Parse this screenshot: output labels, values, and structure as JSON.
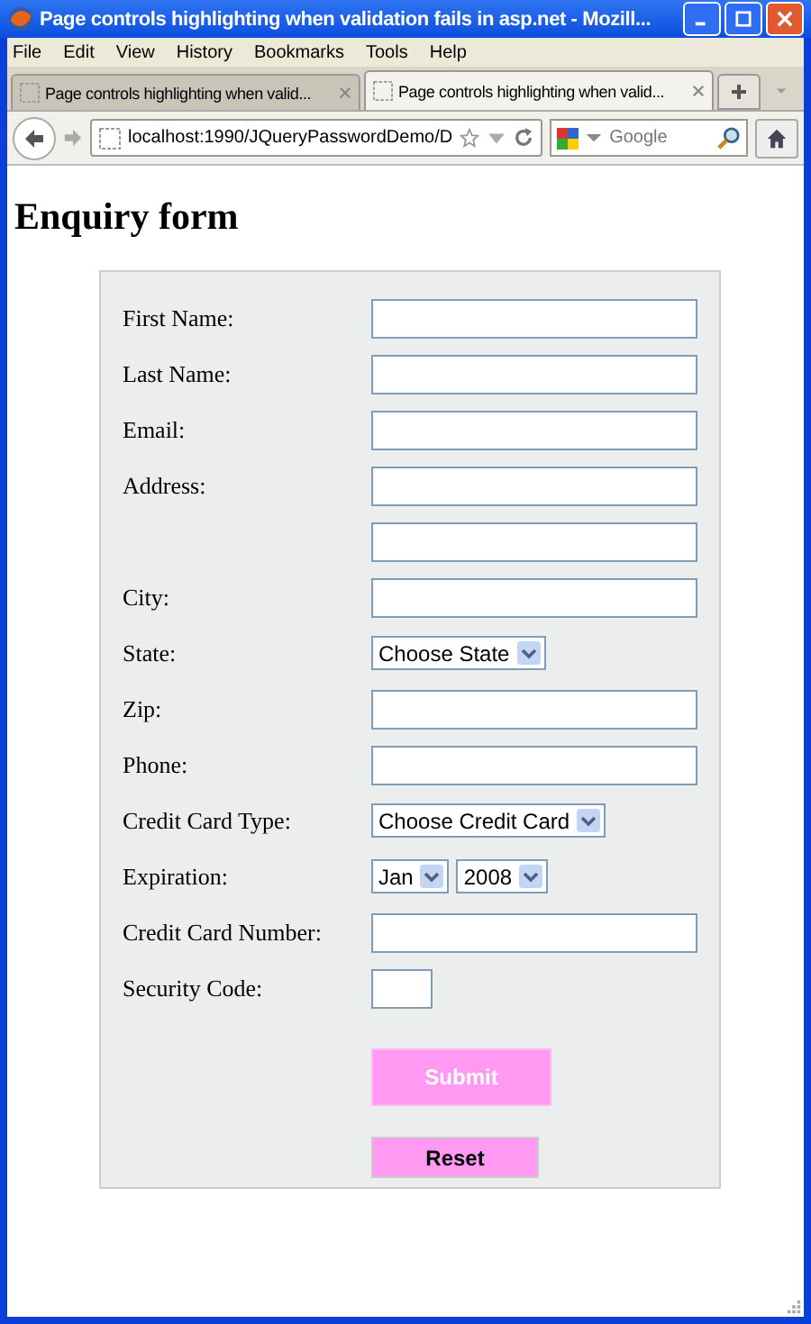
{
  "window": {
    "title": "Page controls highlighting when validation fails in asp.net - Mozill..."
  },
  "menu": [
    "File",
    "Edit",
    "View",
    "History",
    "Bookmarks",
    "Tools",
    "Help"
  ],
  "tabs": [
    {
      "label": "Page controls highlighting when valid...",
      "selected": false
    },
    {
      "label": "Page controls highlighting when valid...",
      "selected": true
    }
  ],
  "address_bar": {
    "value": "localhost:1990/JQueryPasswordDemo/D"
  },
  "search": {
    "placeholder": "Google"
  },
  "page": {
    "heading": "Enquiry form",
    "fields": [
      {
        "kind": "text",
        "label": "First Name:"
      },
      {
        "kind": "text",
        "label": "Last Name:"
      },
      {
        "kind": "text",
        "label": "Email:"
      },
      {
        "kind": "text",
        "label": "Address:"
      },
      {
        "kind": "text"
      },
      {
        "kind": "text",
        "label": "City:"
      },
      {
        "kind": "select",
        "label": "State:",
        "values": [
          "Choose State"
        ]
      },
      {
        "kind": "text",
        "label": "Zip:"
      },
      {
        "kind": "text",
        "label": "Phone:"
      },
      {
        "kind": "select",
        "label": "Credit Card Type:",
        "values": [
          "Choose Credit Card"
        ]
      },
      {
        "kind": "select",
        "label": "Expiration:",
        "values": [
          "Jan",
          "2008"
        ]
      },
      {
        "kind": "text",
        "label": "Credit Card Number:"
      },
      {
        "kind": "short",
        "label": "Security Code:"
      }
    ],
    "buttons": [
      {
        "label": "Submit",
        "disabled": true
      },
      {
        "label": "Reset",
        "disabled": false
      }
    ]
  }
}
